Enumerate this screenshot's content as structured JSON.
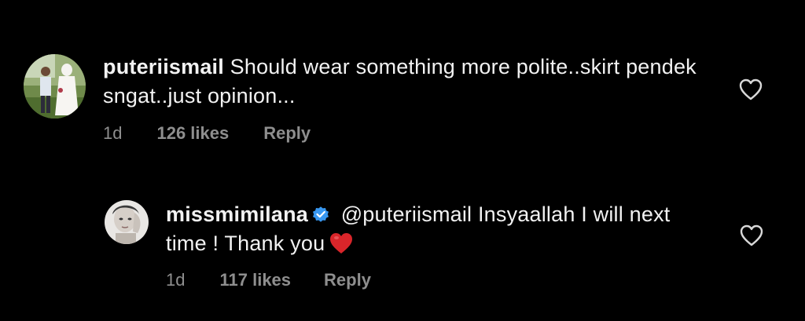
{
  "comments": [
    {
      "username": "puteriismail",
      "text": "Should wear something more polite..skirt pendek sngat..just opinion...",
      "time": "1d",
      "likes": "126 likes",
      "reply_label": "Reply",
      "verified": false,
      "avatar_icon": "couple-photo-avatar",
      "like_icon": "heart-outline-icon"
    },
    {
      "username": "missmimilana",
      "text": "@puteriismail Insyaallah I will next time ! Thank you",
      "time": "1d",
      "likes": "117 likes",
      "reply_label": "Reply",
      "verified": true,
      "verified_icon": "verified-badge-icon",
      "emoji": "red-heart-emoji",
      "avatar_icon": "woman-portrait-avatar",
      "like_icon": "heart-outline-icon"
    }
  ],
  "colors": {
    "background": "#000000",
    "text": "#f2f2f2",
    "meta": "#8e8e8e",
    "verified": "#3897f0",
    "heart_emoji": "#d9252a"
  }
}
